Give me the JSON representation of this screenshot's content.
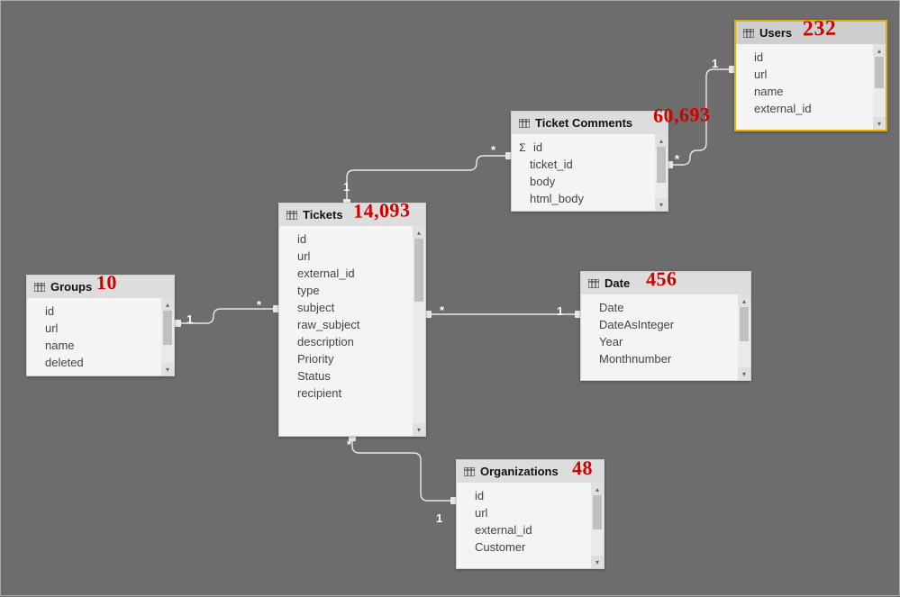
{
  "tables": {
    "groups": {
      "title": "Groups",
      "annotation": "10",
      "fields": [
        "id",
        "url",
        "name",
        "deleted"
      ]
    },
    "tickets": {
      "title": "Tickets",
      "annotation": "14,093",
      "fields": [
        "id",
        "url",
        "external_id",
        "type",
        "subject",
        "raw_subject",
        "description",
        "Priority",
        "Status",
        "recipient"
      ]
    },
    "ticket_comments": {
      "title": "Ticket Comments",
      "annotation": "60,693",
      "fields_sigma": [
        "id"
      ],
      "fields": [
        "ticket_id",
        "body",
        "html_body"
      ]
    },
    "users": {
      "title": "Users",
      "annotation": "232",
      "fields": [
        "id",
        "url",
        "name",
        "external_id"
      ]
    },
    "date": {
      "title": "Date",
      "annotation": "456",
      "fields": [
        "Date",
        "DateAsInteger",
        "Year",
        "Monthnumber"
      ]
    },
    "organizations": {
      "title": "Organizations",
      "annotation": "48",
      "fields": [
        "id",
        "url",
        "external_id",
        "Customer"
      ]
    }
  },
  "cardinality": {
    "one": "1",
    "many": "*"
  },
  "relationships": [
    {
      "from": "groups",
      "from_card": "1",
      "to": "tickets",
      "to_card": "*"
    },
    {
      "from": "tickets",
      "from_card": "1",
      "to": "ticket_comments",
      "to_card": "*"
    },
    {
      "from": "date",
      "from_card": "1",
      "to": "tickets",
      "to_card": "*"
    },
    {
      "from": "organizations",
      "from_card": "1",
      "to": "tickets",
      "to_card": "*"
    },
    {
      "from": "users",
      "from_card": "1",
      "to": "ticket_comments",
      "to_card": "*"
    }
  ]
}
